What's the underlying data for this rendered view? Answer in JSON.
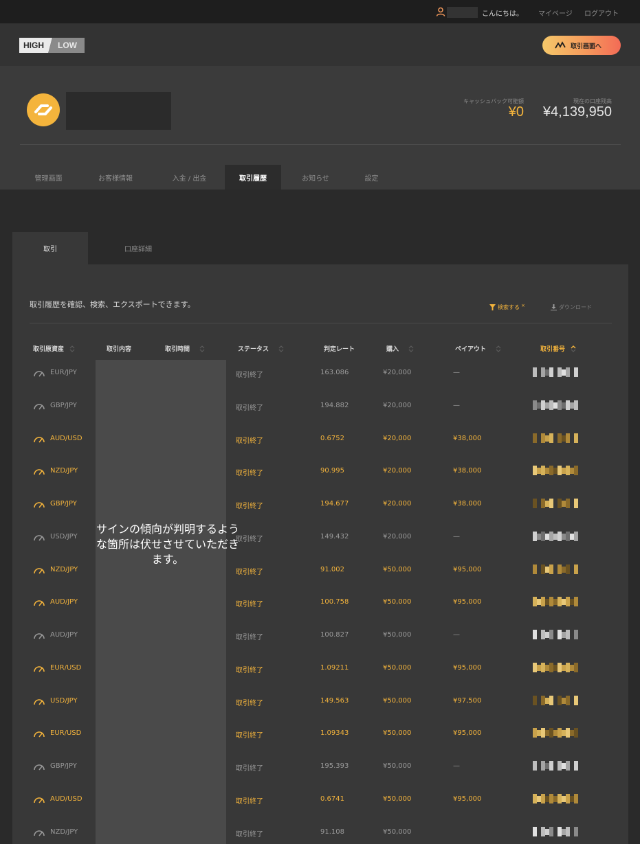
{
  "topbar": {
    "greeting": "こんにちは。",
    "mypage": "マイページ",
    "logout": "ログアウト"
  },
  "header": {
    "logo_high": "HIGH",
    "logo_low": "LOW",
    "trade_button": "取引画面へ"
  },
  "account": {
    "cashback_label": "キャッシュバック可能額",
    "cashback_value": "¥0",
    "balance_label": "現在の口座残高",
    "balance_value": "¥4,139,950"
  },
  "nav_tabs": [
    {
      "label": "管理画面",
      "active": false
    },
    {
      "label": "お客様情報",
      "active": false
    },
    {
      "label": "入金 / 出金",
      "active": false
    },
    {
      "label": "取引履歴",
      "active": true
    },
    {
      "label": "お知らせ",
      "active": false
    },
    {
      "label": "設定",
      "active": false
    }
  ],
  "sub_tabs": [
    {
      "label": "取引",
      "active": true
    },
    {
      "label": "口座詳細",
      "active": false
    }
  ],
  "panel": {
    "description": "取引履歴を確認、検索、エクスポートできます。",
    "search_label": "検索する",
    "download_label": "ダウンロード"
  },
  "table": {
    "columns": [
      "取引原資産",
      "取引内容",
      "取引時間",
      "ステータス",
      "判定レート",
      "購入",
      "ペイアウト",
      "取引番号"
    ],
    "active_sort_column": "取引番号",
    "redaction_note": "サインの傾向が判明するような箇所は伏せさせていただきます。",
    "rows": [
      {
        "asset": "EUR/JPY",
        "status": "取引終了",
        "rate": "163.086",
        "purchase": "¥20,000",
        "payout": "—",
        "win": false
      },
      {
        "asset": "GBP/JPY",
        "status": "取引終了",
        "rate": "194.882",
        "purchase": "¥20,000",
        "payout": "—",
        "win": false
      },
      {
        "asset": "AUD/USD",
        "status": "取引終了",
        "rate": "0.6752",
        "purchase": "¥20,000",
        "payout": "¥38,000",
        "win": true
      },
      {
        "asset": "NZD/JPY",
        "status": "取引終了",
        "rate": "90.995",
        "purchase": "¥20,000",
        "payout": "¥38,000",
        "win": true
      },
      {
        "asset": "GBP/JPY",
        "status": "取引終了",
        "rate": "194.677",
        "purchase": "¥20,000",
        "payout": "¥38,000",
        "win": true
      },
      {
        "asset": "USD/JPY",
        "status": "取引終了",
        "rate": "149.432",
        "purchase": "¥20,000",
        "payout": "—",
        "win": false
      },
      {
        "asset": "NZD/JPY",
        "status": "取引終了",
        "rate": "91.002",
        "purchase": "¥50,000",
        "payout": "¥95,000",
        "win": true
      },
      {
        "asset": "AUD/JPY",
        "status": "取引終了",
        "rate": "100.758",
        "purchase": "¥50,000",
        "payout": "¥95,000",
        "win": true
      },
      {
        "asset": "AUD/JPY",
        "status": "取引終了",
        "rate": "100.827",
        "purchase": "¥50,000",
        "payout": "—",
        "win": false
      },
      {
        "asset": "EUR/USD",
        "status": "取引終了",
        "rate": "1.09211",
        "purchase": "¥50,000",
        "payout": "¥95,000",
        "win": true
      },
      {
        "asset": "USD/JPY",
        "status": "取引終了",
        "rate": "149.563",
        "purchase": "¥50,000",
        "payout": "¥97,500",
        "win": true
      },
      {
        "asset": "EUR/USD",
        "status": "取引終了",
        "rate": "1.09343",
        "purchase": "¥50,000",
        "payout": "¥95,000",
        "win": true
      },
      {
        "asset": "GBP/JPY",
        "status": "取引終了",
        "rate": "195.393",
        "purchase": "¥50,000",
        "payout": "—",
        "win": false
      },
      {
        "asset": "AUD/USD",
        "status": "取引終了",
        "rate": "0.6741",
        "purchase": "¥50,000",
        "payout": "¥95,000",
        "win": true
      },
      {
        "asset": "NZD/JPY",
        "status": "取引終了",
        "rate": "91.108",
        "purchase": "¥50,000",
        "payout": "",
        "win": false
      }
    ]
  },
  "colors": {
    "accent": "#f4b43c",
    "muted": "#a8a8a8",
    "row_win": "#f4b43c",
    "row_loss": "#9a9a9a"
  }
}
